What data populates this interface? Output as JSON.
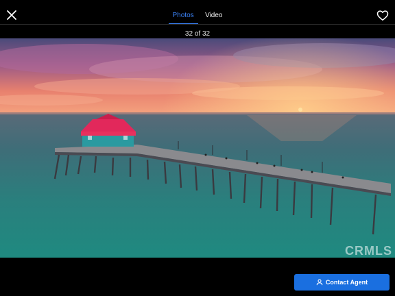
{
  "topbar": {
    "close_icon": "close-icon",
    "favorite_icon": "heart-icon",
    "tabs": [
      {
        "label": "Photos",
        "active": true
      },
      {
        "label": "Video",
        "active": false
      }
    ],
    "active_color": "#3b82f6"
  },
  "gallery": {
    "counter": "32 of 32",
    "current_index": 32,
    "total": 32
  },
  "photo": {
    "watermark": "CRMLS"
  },
  "footer": {
    "contact_label": "Contact Agent",
    "contact_icon": "user-icon",
    "button_color": "#1a6fe0"
  }
}
